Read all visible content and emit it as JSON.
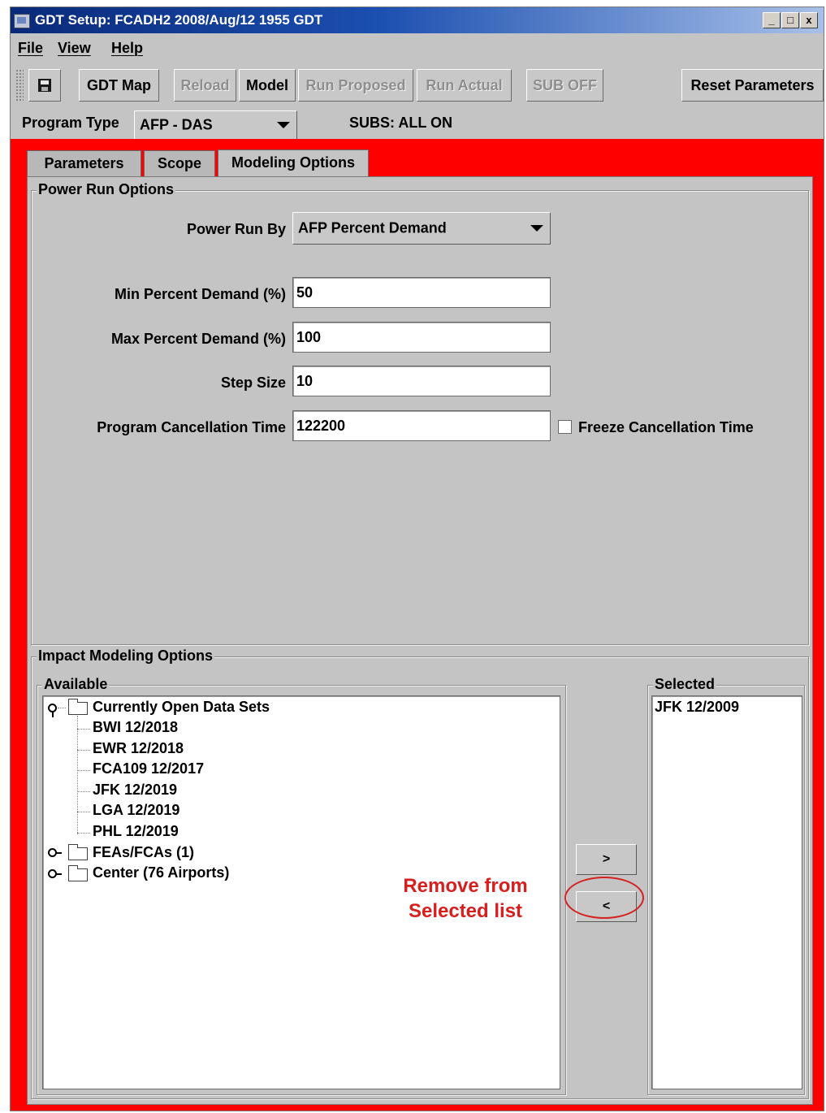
{
  "window": {
    "title": "GDT Setup: FCADH2 2008/Aug/12 1955 GDT",
    "controls": [
      "_",
      "□",
      "x"
    ]
  },
  "menubar": {
    "items": [
      "File",
      "View",
      "Help"
    ]
  },
  "toolbar": {
    "save_icon": "save-icon",
    "gdt_map": "GDT Map",
    "reload": "Reload",
    "model": "Model",
    "run_proposed": "Run Proposed",
    "run_actual": "Run Actual",
    "sub_off": "SUB OFF",
    "reset_parameters": "Reset Parameters"
  },
  "program": {
    "label": "Program Type",
    "value": "AFP - DAS",
    "subs_status": "SUBS: ALL ON"
  },
  "tabs": [
    {
      "label": "Parameters",
      "active": false
    },
    {
      "label": "Scope",
      "active": false
    },
    {
      "label": "Modeling Options",
      "active": true
    }
  ],
  "power_run": {
    "title": "Power Run Options",
    "run_by_label": "Power Run By",
    "run_by_value": "AFP Percent Demand",
    "min_label": "Min Percent Demand (%)",
    "min_value": "50",
    "max_label": "Max Percent Demand (%)",
    "max_value": "100",
    "step_label": "Step Size",
    "step_value": "10",
    "cancel_label": "Program Cancellation Time",
    "cancel_value": "122200",
    "freeze_label": "Freeze Cancellation Time",
    "freeze_checked": false
  },
  "impact": {
    "title": "Impact Modeling Options",
    "available_title": "Available",
    "selected_title": "Selected",
    "tree": {
      "root": "Currently Open Data Sets",
      "children": [
        "BWI 12/2018",
        "EWR 12/2018",
        "FCA109 12/2017",
        "JFK 12/2019",
        "LGA 12/2019",
        "PHL 12/2019"
      ],
      "collapsed": [
        "FEAs/FCAs (1)",
        "Center (76 Airports)"
      ]
    },
    "add_button": ">",
    "remove_button": "<",
    "selected_items": [
      "JFK 12/2009"
    ]
  },
  "annotation": {
    "line1": "Remove from",
    "line2": "Selected list",
    "color": "#d62020"
  },
  "colors": {
    "highlight_frame": "#ff0000",
    "window_bg": "#c4c4c4"
  }
}
